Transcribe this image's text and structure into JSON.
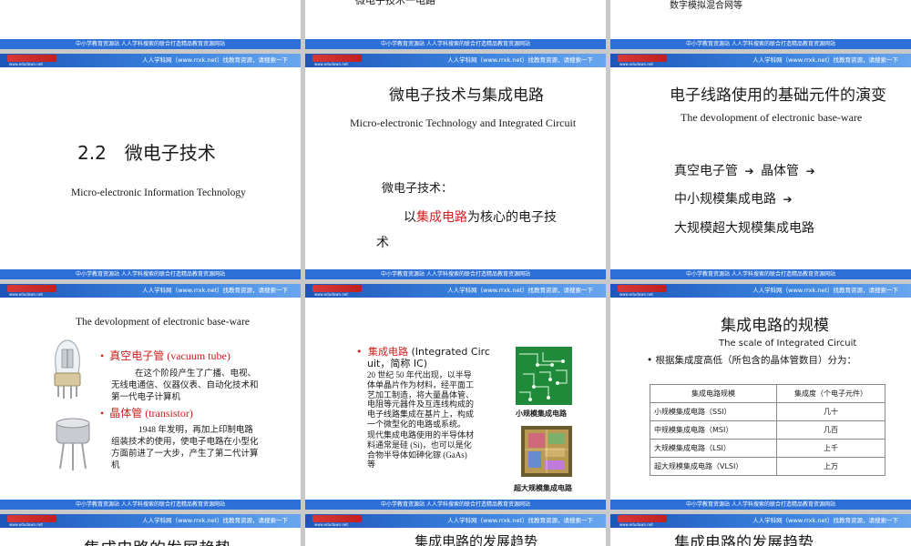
{
  "common": {
    "footer_text": "中小学教育资源站 人人学科搜索的联合打造精品教育资源网站",
    "header_banner": "人人学科网（www.rrxk.net）找教育资源，请搜索一下",
    "logo_url": "www.edudown.net"
  },
  "row0": {
    "slide2_partial": "微电子技术一电路",
    "slide3_partial": "数字模拟混合网等"
  },
  "slide1": {
    "title": "2.2　微电子技术",
    "subtitle": "Micro-electronic Information Technology"
  },
  "slide2": {
    "title": "微电子技术与集成电路",
    "subtitle": "Micro-electronic Technology and Integrated Circuit",
    "label": "微电子技术：",
    "def_prefix": "以",
    "def_red": "集成电路",
    "def_suffix": "为核心的电子技",
    "def_wrap": "术"
  },
  "slide3": {
    "title": "电子线路使用的基础元件的演变",
    "subtitle": "The devolopment of electronic base-ware",
    "line1_a": "真空电子管",
    "line1_b": "晶体管",
    "line2": "中小规模集成电路",
    "line3": "大规模超大规模集成电路",
    "arrow": "➔"
  },
  "slide4": {
    "title": "The devolopment of electronic base-ware",
    "b1_head": "真空电子管 (vacuum tube)",
    "b1_l1": "在这个阶段产生了广播、电视、",
    "b1_l2": "无线电通信、仪器仪表、自动化技术和",
    "b1_l3": "第一代电子计算机",
    "b2_head": "晶体管 (transistor)",
    "b2_l1": "1948 年发明，再加上印制电路",
    "b2_l2": "组装技术的使用，使电子电路在小型化",
    "b2_l3": "方面前进了一大步，产生了第二代计算",
    "b2_l4": "机"
  },
  "slide5": {
    "head_red": "集成电路",
    "head_rest": " (Integrated Circ",
    "head_l2": "uit，简称 IC)",
    "p1": [
      "20 世纪 50 年代出现，以半导",
      "体单晶片作为材料，经平面工",
      "艺加工制造，将大量晶体管、",
      "电阻等元器件及互连线构成的",
      "电子线路集成在基片上，构成",
      "一个微型化的电路或系统。"
    ],
    "p2": [
      "现代集成电路使用的半导体材",
      "料通常是硅 (Si)，也可以是化",
      "合物半导体如砷化镓 (GaAs)",
      "等"
    ],
    "cap1": "小规模集成电路",
    "cap2": "超大规模集成电路"
  },
  "slide6": {
    "title": "集成电路的规模",
    "subtitle": "The scale of Integrated Circuit",
    "desc": "• 根据集成度高低（所包含的晶体管数目）分为：",
    "table_headers": [
      "集成电路规模",
      "集成度（个电子元件）"
    ],
    "table_rows": [
      [
        "小规模集成电路（SSI）",
        "几十"
      ],
      [
        "中规模集成电路（MSI）",
        "几百"
      ],
      [
        "大规模集成电路（LSI）",
        "上千"
      ],
      [
        "超大规模集成电路（VLSI）",
        "上万"
      ]
    ]
  },
  "row3": {
    "t1": "集成电路的发展趋势",
    "t2": "集成电路的发展趋势",
    "t3": "集成电路的发展趋势"
  }
}
